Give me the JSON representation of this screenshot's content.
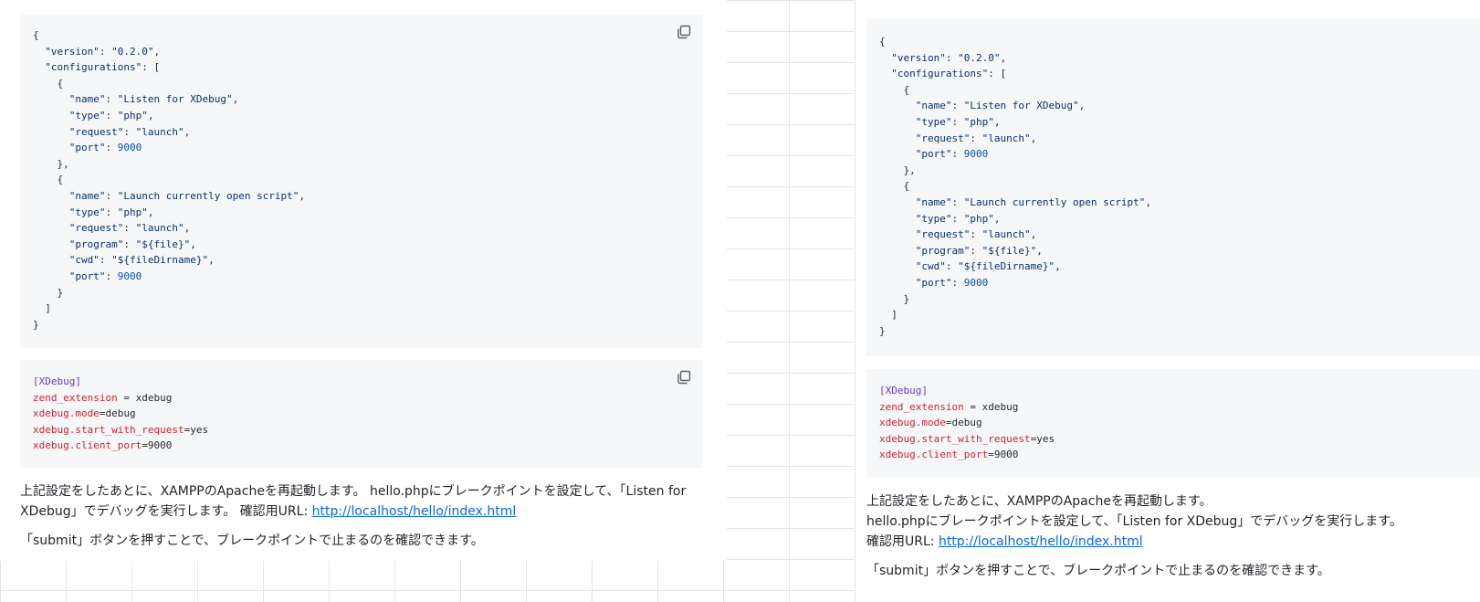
{
  "json_code": {
    "lines": [
      [
        {
          "t": "{"
        }
      ],
      [
        {
          "t": "  "
        },
        {
          "t": "\"version\"",
          "c": "k"
        },
        {
          "t": ": "
        },
        {
          "t": "\"0.2.0\"",
          "c": "s"
        },
        {
          "t": ","
        }
      ],
      [
        {
          "t": "  "
        },
        {
          "t": "\"configurations\"",
          "c": "k"
        },
        {
          "t": ": ["
        }
      ],
      [
        {
          "t": "    {"
        }
      ],
      [
        {
          "t": "      "
        },
        {
          "t": "\"name\"",
          "c": "k"
        },
        {
          "t": ": "
        },
        {
          "t": "\"Listen for XDebug\"",
          "c": "s"
        },
        {
          "t": ","
        }
      ],
      [
        {
          "t": "      "
        },
        {
          "t": "\"type\"",
          "c": "k"
        },
        {
          "t": ": "
        },
        {
          "t": "\"php\"",
          "c": "s"
        },
        {
          "t": ","
        }
      ],
      [
        {
          "t": "      "
        },
        {
          "t": "\"request\"",
          "c": "k"
        },
        {
          "t": ": "
        },
        {
          "t": "\"launch\"",
          "c": "s"
        },
        {
          "t": ","
        }
      ],
      [
        {
          "t": "      "
        },
        {
          "t": "\"port\"",
          "c": "k"
        },
        {
          "t": ": "
        },
        {
          "t": "9000",
          "c": "n"
        }
      ],
      [
        {
          "t": "    },"
        }
      ],
      [
        {
          "t": "    {"
        }
      ],
      [
        {
          "t": "      "
        },
        {
          "t": "\"name\"",
          "c": "k"
        },
        {
          "t": ": "
        },
        {
          "t": "\"Launch currently open script\"",
          "c": "s"
        },
        {
          "t": ","
        }
      ],
      [
        {
          "t": "      "
        },
        {
          "t": "\"type\"",
          "c": "k"
        },
        {
          "t": ": "
        },
        {
          "t": "\"php\"",
          "c": "s"
        },
        {
          "t": ","
        }
      ],
      [
        {
          "t": "      "
        },
        {
          "t": "\"request\"",
          "c": "k"
        },
        {
          "t": ": "
        },
        {
          "t": "\"launch\"",
          "c": "s"
        },
        {
          "t": ","
        }
      ],
      [
        {
          "t": "      "
        },
        {
          "t": "\"program\"",
          "c": "k"
        },
        {
          "t": ": "
        },
        {
          "t": "\"${file}\"",
          "c": "s"
        },
        {
          "t": ","
        }
      ],
      [
        {
          "t": "      "
        },
        {
          "t": "\"cwd\"",
          "c": "k"
        },
        {
          "t": ": "
        },
        {
          "t": "\"${fileDirname}\"",
          "c": "s"
        },
        {
          "t": ","
        }
      ],
      [
        {
          "t": "      "
        },
        {
          "t": "\"port\"",
          "c": "k"
        },
        {
          "t": ": "
        },
        {
          "t": "9000",
          "c": "n"
        }
      ],
      [
        {
          "t": "    }"
        }
      ],
      [
        {
          "t": "  ]"
        }
      ],
      [
        {
          "t": "}"
        }
      ]
    ]
  },
  "ini_code": {
    "lines": [
      [
        {
          "t": "[XDebug]",
          "c": "sec"
        }
      ],
      [
        {
          "t": "zend_extension",
          "c": "ikey"
        },
        {
          "t": " = xdebug"
        }
      ],
      [
        {
          "t": "xdebug.mode",
          "c": "ikey"
        },
        {
          "t": "=debug"
        }
      ],
      [
        {
          "t": "xdebug.start_with_request",
          "c": "ikey"
        },
        {
          "t": "=yes"
        }
      ],
      [
        {
          "t": "xdebug.client_port",
          "c": "ikey"
        },
        {
          "t": "=9000"
        }
      ]
    ]
  },
  "left_prose": {
    "p1_line1": "上記設定をしたあとに、XAMPPのApacheを再起動します。 hello.phpにブレークポイントを設定して、「Listen for",
    "p1_line2_prefix": "XDebug」でデバッグを実行します。 確認用URL: ",
    "link_text": "http://localhost/hello/index.html",
    "p2": "「submit」ボタンを押すことで、ブレークポイントで止まるのを確認できます。"
  },
  "right_prose": {
    "line1": "上記設定をしたあとに、XAMPPのApacheを再起動します。",
    "line2": "hello.phpにブレークポイントを設定して、「Listen for XDebug」でデバッグを実行します。",
    "line3_prefix": "確認用URL: ",
    "link_text": "http://localhost/hello/index.html",
    "p2": "「submit」ボタンを押すことで、ブレークポイントで止まるのを確認できます。"
  },
  "icons": {
    "copy": "copy-icon"
  },
  "colors": {
    "code_bg": "#f6f7f9",
    "string": "#0a3069",
    "number": "#0550ae",
    "ini_section": "#6639ba",
    "ini_key": "#cf222e",
    "link": "#0969da"
  }
}
